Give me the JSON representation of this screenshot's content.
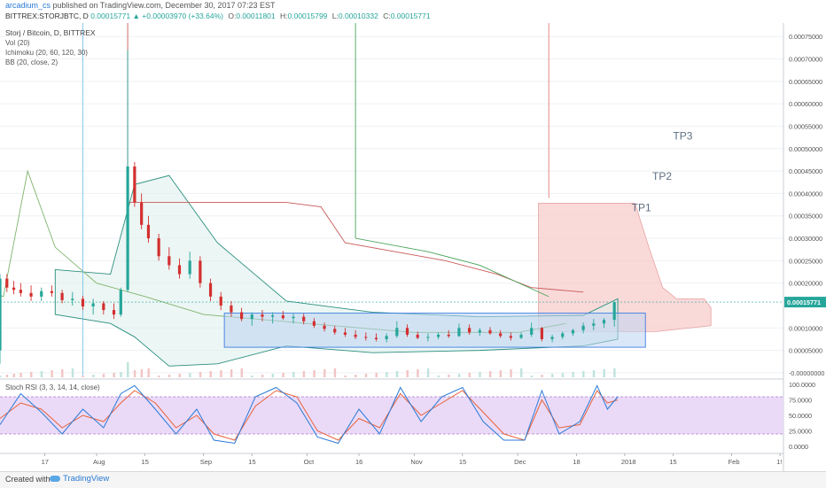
{
  "header": {
    "author": "arcadium_cs",
    "published_text": "published on TradingView.com, December 30, 2017 07:23 EST",
    "symbol": "BITTREX:STORJBTC, D",
    "price": "0.00015771",
    "change_arrow": "▲",
    "change": "+0.00003970 (+33.64%)",
    "ohlc": [
      {
        "label": "O:",
        "value": "0.00011801"
      },
      {
        "label": "H:",
        "value": "0.00015799"
      },
      {
        "label": "L:",
        "value": "0.00010332"
      },
      {
        "label": "C:",
        "value": "0.00015771"
      }
    ]
  },
  "legend": {
    "title": "Storj / Bitcoin, D, BITTREX",
    "items": [
      "Vol (20)",
      "Ichimoku (20, 60, 120, 30)",
      "BB (20, close, 2)"
    ]
  },
  "price_axis_labels": [
    "0.00075000",
    "0.00070000",
    "0.00065000",
    "0.00060000",
    "0.00055000",
    "0.00050000",
    "0.00045000",
    "0.00040000",
    "0.00035000",
    "0.00030000",
    "0.00025000",
    "0.00020000",
    "0.00010000",
    "0.00005000",
    "-0.00000000"
  ],
  "last_price_label": "0.00015771",
  "targets": [
    "TP1",
    "TP2",
    "TP3"
  ],
  "stoch": {
    "title": "Stoch RSI (3, 3, 14, 14, close)",
    "axis_labels": [
      "100.0000",
      "75.0000",
      "50.0000",
      "25.0000",
      "0.0000"
    ]
  },
  "time_axis_labels": [
    "17",
    "Aug",
    "15",
    "Sep",
    "15",
    "Oct",
    "16",
    "Nov",
    "15",
    "Dec",
    "18",
    "2018",
    "15",
    "Feb",
    "1!"
  ],
  "footer": {
    "created": "Created with",
    "brand": "TradingView"
  },
  "colors": {
    "up": "#26a69a",
    "down": "#d32f2f",
    "kumo": "#f8c9c9",
    "box_fill": "#bcd3f2",
    "box_stroke": "#3b7de0",
    "stoch_band": "#e8d6f7",
    "k_line": "#2a7ad6",
    "d_line": "#e8623a"
  },
  "chart_data": {
    "type": "candlestick",
    "title": "Storj / Bitcoin, D, BITTREX",
    "x_start": "2017-07-04",
    "x_end": "2018-02-16",
    "ylim": [
      -1e-05,
      0.00078
    ],
    "ohlc": [
      [
        "2017-07-04",
        5e-05,
        0.00022,
        2e-05,
        0.00021
      ],
      [
        "2017-07-06",
        0.00021,
        0.00022,
        0.00018,
        0.00019
      ],
      [
        "2017-07-08",
        0.00019,
        0.000205,
        0.000175,
        0.000185
      ],
      [
        "2017-07-10",
        0.000185,
        0.0002,
        0.00017,
        0.000178
      ],
      [
        "2017-07-13",
        0.000178,
        0.000195,
        0.00016,
        0.00017
      ],
      [
        "2017-07-16",
        0.00017,
        0.00019,
        0.00016,
        0.000182
      ],
      [
        "2017-07-19",
        0.000182,
        0.000195,
        0.00017,
        0.000178
      ],
      [
        "2017-07-22",
        0.000178,
        0.000185,
        0.000155,
        0.000162
      ],
      [
        "2017-07-25",
        0.000162,
        0.00018,
        0.00015,
        0.000165
      ],
      [
        "2017-07-28",
        0.000165,
        0.000172,
        0.00014,
        0.000148
      ],
      [
        "2017-07-31",
        0.000148,
        0.000165,
        0.00013,
        0.000155
      ],
      [
        "2017-08-03",
        0.000155,
        0.00016,
        0.00013,
        0.00014
      ],
      [
        "2017-08-06",
        0.00014,
        0.000155,
        0.00012,
        0.00013
      ],
      [
        "2017-08-08",
        0.00013,
        0.00019,
        0.000125,
        0.000185
      ],
      [
        "2017-08-10",
        0.000185,
        0.00072,
        0.00018,
        0.00046
      ],
      [
        "2017-08-12",
        0.00046,
        0.00047,
        0.00037,
        0.00038
      ],
      [
        "2017-08-14",
        0.00038,
        0.0004,
        0.00032,
        0.00033
      ],
      [
        "2017-08-16",
        0.00033,
        0.00035,
        0.00029,
        0.0003
      ],
      [
        "2017-08-19",
        0.0003,
        0.00031,
        0.00025,
        0.00026
      ],
      [
        "2017-08-22",
        0.00026,
        0.00028,
        0.00023,
        0.00024
      ],
      [
        "2017-08-25",
        0.00024,
        0.000255,
        0.00021,
        0.00022
      ],
      [
        "2017-08-28",
        0.00022,
        0.00027,
        0.00021,
        0.00025
      ],
      [
        "2017-08-31",
        0.00025,
        0.00026,
        0.00019,
        0.0002
      ],
      [
        "2017-09-03",
        0.0002,
        0.00021,
        0.00016,
        0.00017
      ],
      [
        "2017-09-06",
        0.00017,
        0.00018,
        0.00014,
        0.00015
      ],
      [
        "2017-09-09",
        0.00015,
        0.00016,
        0.000125,
        0.000135
      ],
      [
        "2017-09-12",
        0.000135,
        0.000145,
        0.000115,
        0.00012
      ],
      [
        "2017-09-15",
        0.00012,
        0.000135,
        0.000105,
        0.00013
      ],
      [
        "2017-09-18",
        0.00013,
        0.00014,
        0.000115,
        0.000125
      ],
      [
        "2017-09-21",
        0.000125,
        0.000135,
        0.00011,
        0.000128
      ],
      [
        "2017-09-24",
        0.000128,
        0.000138,
        0.000118,
        0.000122
      ],
      [
        "2017-09-27",
        0.000122,
        0.000132,
        0.00011,
        0.000125
      ],
      [
        "2017-09-30",
        0.000125,
        0.000132,
        0.000108,
        0.000115
      ],
      [
        "2017-10-03",
        0.000115,
        0.000122,
        0.0001,
        0.000105
      ],
      [
        "2017-10-06",
        0.000105,
        0.000112,
        9.2e-05,
        9.8e-05
      ],
      [
        "2017-10-09",
        9.8e-05,
        0.000105,
        8.5e-05,
        9e-05
      ],
      [
        "2017-10-12",
        9e-05,
        0.0001,
        8e-05,
        8.5e-05
      ],
      [
        "2017-10-15",
        8.5e-05,
        9.5e-05,
        7.5e-05,
        8e-05
      ],
      [
        "2017-10-18",
        8e-05,
        9e-05,
        7.2e-05,
        7.8e-05
      ],
      [
        "2017-10-21",
        7.8e-05,
        8.8e-05,
        7e-05,
        7.5e-05
      ],
      [
        "2017-10-24",
        7.5e-05,
        8.8e-05,
        6.8e-05,
        8.2e-05
      ],
      [
        "2017-10-27",
        8.2e-05,
        0.000115,
        7.8e-05,
        0.0001
      ],
      [
        "2017-10-30",
        0.0001,
        0.000108,
        8e-05,
        8.5e-05
      ],
      [
        "2017-11-02",
        8.5e-05,
        9.2e-05,
        7.5e-05,
        7.8e-05
      ],
      [
        "2017-11-05",
        7.8e-05,
        8.8e-05,
        7e-05,
        8e-05
      ],
      [
        "2017-11-08",
        8e-05,
        9e-05,
        7.5e-05,
        8.5e-05
      ],
      [
        "2017-11-11",
        8.5e-05,
        9.5e-05,
        7.8e-05,
        8.2e-05
      ],
      [
        "2017-11-14",
        8.2e-05,
        0.00011,
        8e-05,
        0.0001
      ],
      [
        "2017-11-17",
        0.0001,
        0.000108,
        8.5e-05,
        9e-05
      ],
      [
        "2017-11-20",
        9e-05,
        0.0001,
        8.2e-05,
        9.5e-05
      ],
      [
        "2017-11-23",
        9.5e-05,
        0.000102,
        8.5e-05,
        8.8e-05
      ],
      [
        "2017-11-26",
        8.8e-05,
        9.5e-05,
        7.8e-05,
        8.2e-05
      ],
      [
        "2017-11-29",
        8.2e-05,
        9e-05,
        7.2e-05,
        7.8e-05
      ],
      [
        "2017-12-02",
        7.8e-05,
        9e-05,
        7.5e-05,
        8.5e-05
      ],
      [
        "2017-12-05",
        8.5e-05,
        0.000112,
        8e-05,
        0.0001
      ],
      [
        "2017-12-08",
        0.0001,
        0.000102,
        7e-05,
        7.5e-05
      ],
      [
        "2017-12-11",
        7.5e-05,
        8.5e-05,
        6.8e-05,
        8e-05
      ],
      [
        "2017-12-14",
        8e-05,
        9.2e-05,
        7.5e-05,
        8.8e-05
      ],
      [
        "2017-12-17",
        8.8e-05,
        9.8e-05,
        8.2e-05,
        9.5e-05
      ],
      [
        "2017-12-20",
        9.5e-05,
        0.000112,
        8.8e-05,
        0.000105
      ],
      [
        "2017-12-23",
        0.000105,
        0.00012,
        9.5e-05,
        0.00011
      ],
      [
        "2017-12-26",
        0.00011,
        0.000122,
        0.0001,
        0.000118
      ],
      [
        "2017-12-29",
        0.000118,
        0.000158,
        0.000103,
        0.000158
      ]
    ],
    "rectangle_zone": {
      "x": [
        "2017-09-07",
        "2018-01-07"
      ],
      "y": [
        5.7e-05,
        0.000133
      ]
    },
    "targets": [
      {
        "label": "TP1",
        "price": 0.00036
      },
      {
        "label": "TP2",
        "price": 0.00043
      },
      {
        "label": "TP3",
        "price": 0.00052
      }
    ],
    "stoch_k": [
      [
        "2017-07-04",
        35
      ],
      [
        "2017-07-10",
        85
      ],
      [
        "2017-07-16",
        55
      ],
      [
        "2017-07-22",
        20
      ],
      [
        "2017-07-28",
        60
      ],
      [
        "2017-08-03",
        30
      ],
      [
        "2017-08-08",
        85
      ],
      [
        "2017-08-12",
        98
      ],
      [
        "2017-08-18",
        60
      ],
      [
        "2017-08-24",
        20
      ],
      [
        "2017-08-30",
        60
      ],
      [
        "2017-09-04",
        10
      ],
      [
        "2017-09-10",
        5
      ],
      [
        "2017-09-16",
        80
      ],
      [
        "2017-09-22",
        95
      ],
      [
        "2017-09-28",
        70
      ],
      [
        "2017-10-04",
        15
      ],
      [
        "2017-10-10",
        5
      ],
      [
        "2017-10-16",
        60
      ],
      [
        "2017-10-22",
        20
      ],
      [
        "2017-10-28",
        95
      ],
      [
        "2017-11-03",
        40
      ],
      [
        "2017-11-09",
        80
      ],
      [
        "2017-11-15",
        95
      ],
      [
        "2017-11-21",
        40
      ],
      [
        "2017-11-27",
        10
      ],
      [
        "2017-12-03",
        10
      ],
      [
        "2017-12-08",
        90
      ],
      [
        "2017-12-13",
        20
      ],
      [
        "2017-12-19",
        40
      ],
      [
        "2017-12-24",
        98
      ],
      [
        "2017-12-27",
        60
      ],
      [
        "2017-12-30",
        80
      ]
    ],
    "stoch_d": [
      [
        "2017-07-04",
        45
      ],
      [
        "2017-07-10",
        70
      ],
      [
        "2017-07-16",
        60
      ],
      [
        "2017-07-22",
        30
      ],
      [
        "2017-07-28",
        50
      ],
      [
        "2017-08-03",
        40
      ],
      [
        "2017-08-08",
        70
      ],
      [
        "2017-08-12",
        90
      ],
      [
        "2017-08-18",
        70
      ],
      [
        "2017-08-24",
        30
      ],
      [
        "2017-08-30",
        50
      ],
      [
        "2017-09-04",
        20
      ],
      [
        "2017-09-10",
        10
      ],
      [
        "2017-09-16",
        65
      ],
      [
        "2017-09-22",
        90
      ],
      [
        "2017-09-28",
        80
      ],
      [
        "2017-10-04",
        25
      ],
      [
        "2017-10-10",
        10
      ],
      [
        "2017-10-16",
        45
      ],
      [
        "2017-10-22",
        30
      ],
      [
        "2017-10-28",
        85
      ],
      [
        "2017-11-03",
        50
      ],
      [
        "2017-11-09",
        70
      ],
      [
        "2017-11-15",
        90
      ],
      [
        "2017-11-21",
        55
      ],
      [
        "2017-11-27",
        20
      ],
      [
        "2017-12-03",
        10
      ],
      [
        "2017-12-08",
        75
      ],
      [
        "2017-12-13",
        30
      ],
      [
        "2017-12-19",
        35
      ],
      [
        "2017-12-24",
        90
      ],
      [
        "2017-12-27",
        70
      ],
      [
        "2017-12-30",
        75
      ]
    ]
  }
}
